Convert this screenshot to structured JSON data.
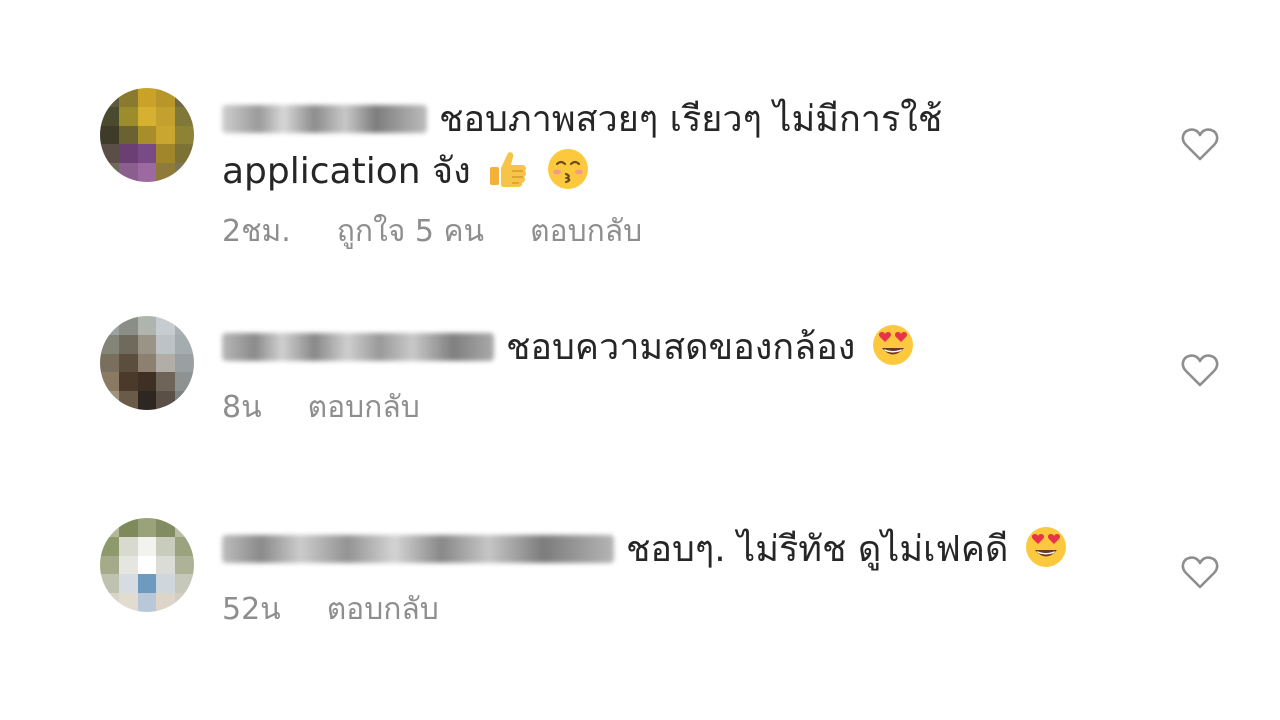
{
  "comments": [
    {
      "text_line1": "ชอบภาพสวยๆ เรียวๆ ไม่มีการใช้",
      "text_line2": "application จัง",
      "time": "2ชม.",
      "likes": "ถูกใจ 5 คน",
      "reply": "ตอบกลับ",
      "emojis": [
        "thumbs-up",
        "kissing-face"
      ]
    },
    {
      "text_line1": "ชอบความสดของกล้อง",
      "time": "8น",
      "reply": "ตอบกลับ",
      "emojis": [
        "heart-eyes"
      ]
    },
    {
      "text_line1": "ชอบๆ. ไม่รีทัช ดูไม่เฟคดี",
      "time": "52น",
      "reply": "ตอบกลับ",
      "emojis": [
        "heart-eyes"
      ]
    }
  ],
  "colors": {
    "text": "#262626",
    "meta": "#8e8e8e",
    "heart_outline": "#8e8e8e"
  }
}
